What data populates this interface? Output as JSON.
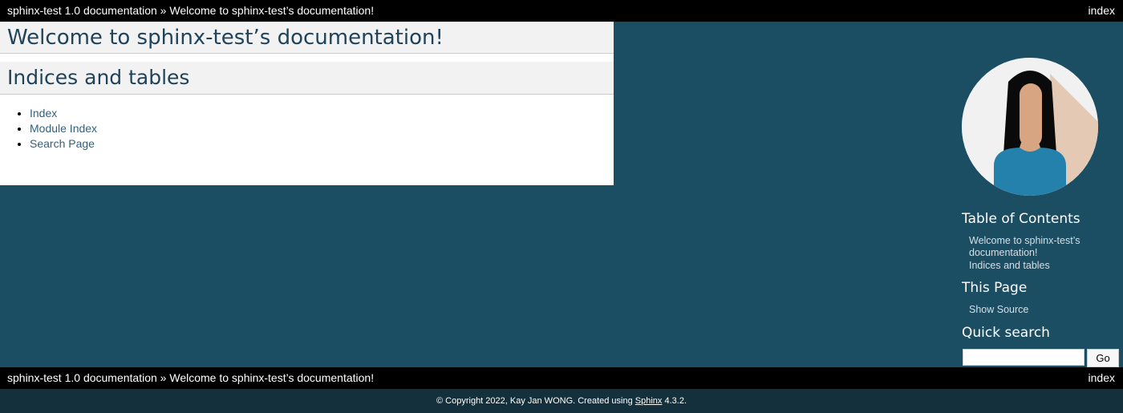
{
  "relbar": {
    "project": "sphinx-test 1.0 documentation",
    "separator": " » ",
    "current": "Welcome to sphinx-test’s documentation!",
    "index_link": "index"
  },
  "document": {
    "title": "Welcome to sphinx-test’s documentation!",
    "section": "Indices and tables",
    "links": [
      "Index",
      "Module Index",
      "Search Page"
    ]
  },
  "sidebar": {
    "toc_heading": "Table of Contents",
    "toc_items": [
      "Welcome to sphinx-test’s documentation!",
      "Indices and tables"
    ],
    "this_page_heading": "This Page",
    "show_source": "Show Source",
    "search_heading": "Quick search",
    "search_button": "Go",
    "search_value": ""
  },
  "footer": {
    "copyright_prefix": "© Copyright 2022, Kay Jan WONG. Created using ",
    "sphinx_link": "Sphinx",
    "version_suffix": " 4.3.2."
  },
  "colors": {
    "background": "#1c4e63",
    "relbar": "#000000",
    "heading_text": "#20435c",
    "link": "#355f7c",
    "footer": "#14303d"
  }
}
